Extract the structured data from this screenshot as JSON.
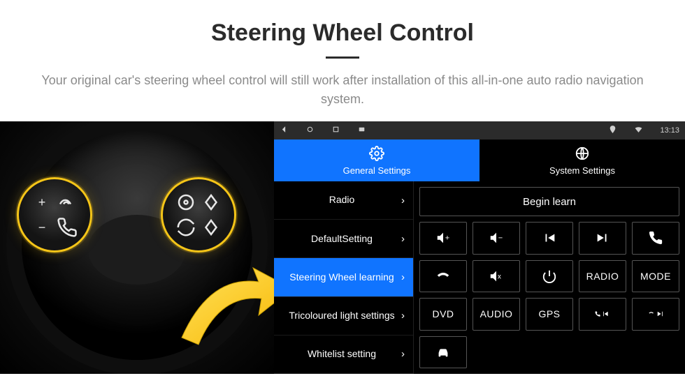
{
  "header": {
    "title": "Steering Wheel Control",
    "subtitle": "Your original car's steering wheel control will still work after installation of this all-in-one auto radio navigation system."
  },
  "navbar": {
    "time": "13:13"
  },
  "tabs": {
    "general": "General Settings",
    "system": "System Settings"
  },
  "sidebar": {
    "items": [
      {
        "label": "Radio"
      },
      {
        "label": "DefaultSetting"
      },
      {
        "label": "Steering Wheel learning",
        "active": true
      },
      {
        "label": "Tricoloured light settings"
      },
      {
        "label": "Whitelist setting"
      }
    ]
  },
  "panel": {
    "begin": "Begin learn",
    "buttons": {
      "dvd": "DVD",
      "audio": "AUDIO",
      "gps": "GPS",
      "radio": "RADIO",
      "mode": "MODE"
    }
  },
  "pods": {
    "plus": "+",
    "minus": "−"
  }
}
